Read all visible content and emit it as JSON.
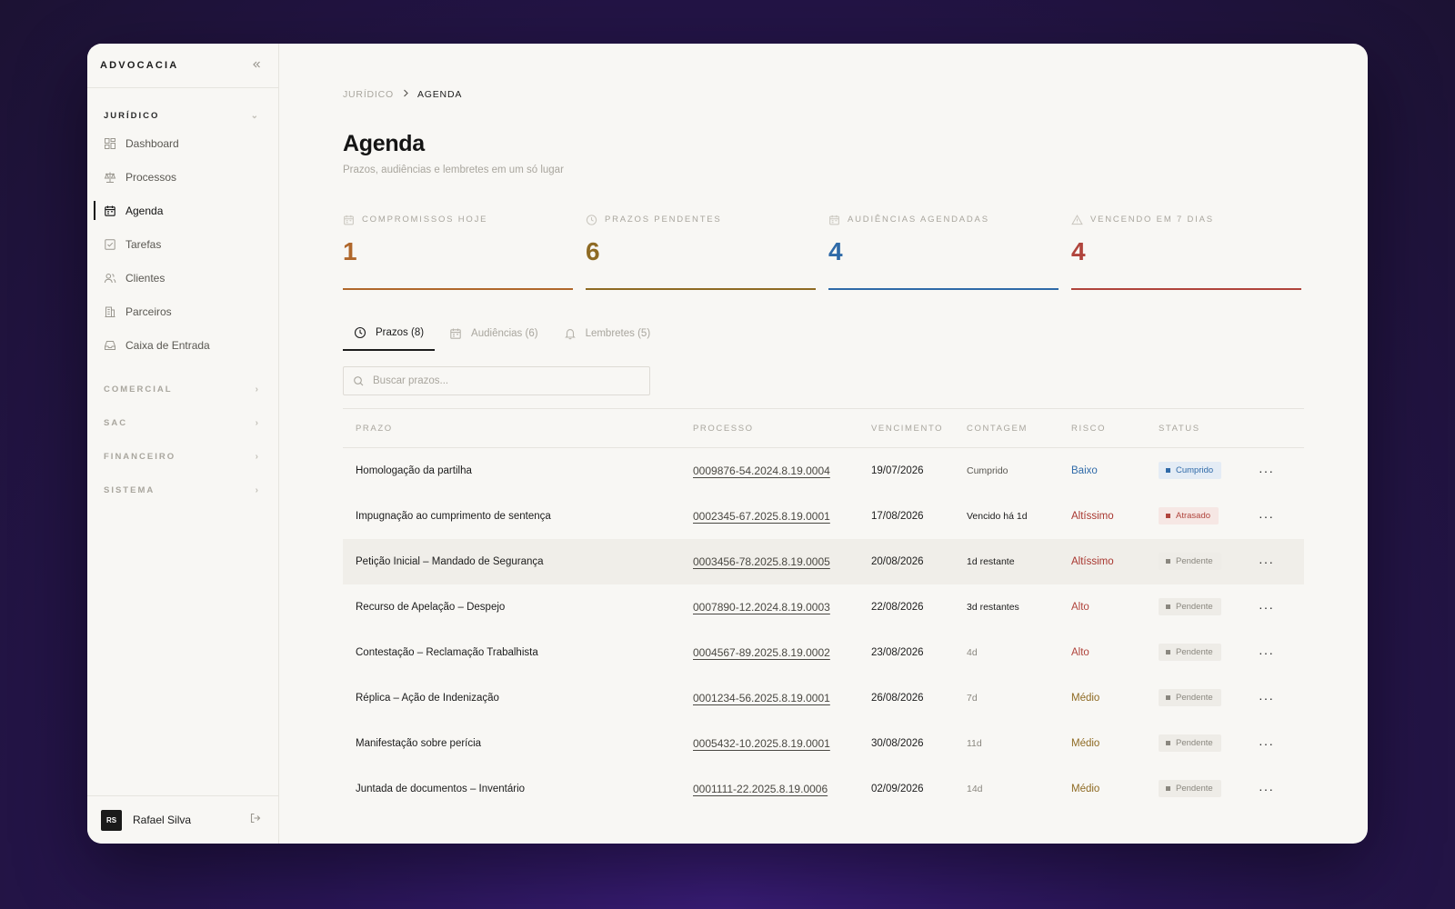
{
  "app": {
    "brand": "ADVOCACIA"
  },
  "sidebar": {
    "group_juridico": "JURÍDICO",
    "items": [
      {
        "label": "Dashboard",
        "icon": "dashboard-icon"
      },
      {
        "label": "Processos",
        "icon": "scale-icon"
      },
      {
        "label": "Agenda",
        "icon": "calendar-icon",
        "active": true
      },
      {
        "label": "Tarefas",
        "icon": "checkbox-icon"
      },
      {
        "label": "Clientes",
        "icon": "users-icon"
      },
      {
        "label": "Parceiros",
        "icon": "building-icon"
      },
      {
        "label": "Caixa de Entrada",
        "icon": "inbox-icon"
      }
    ],
    "groups": [
      "COMERCIAL",
      "SAC",
      "FINANCEIRO",
      "SISTEMA"
    ],
    "user": {
      "initials": "RS",
      "name": "Rafael Silva"
    }
  },
  "breadcrumb": {
    "root": "JURÍDICO",
    "current": "AGENDA"
  },
  "page": {
    "title": "Agenda",
    "subtitle": "Prazos, audiências e lembretes em um só lugar"
  },
  "stats": [
    {
      "label": "COMPROMISSOS HOJE",
      "value": "1",
      "color": "#b0672b",
      "icon": "calendar-icon"
    },
    {
      "label": "PRAZOS PENDENTES",
      "value": "6",
      "color": "#8e6a23",
      "icon": "clock-icon"
    },
    {
      "label": "AUDIÊNCIAS AGENDADAS",
      "value": "4",
      "color": "#2f6aa8",
      "icon": "calendar-icon"
    },
    {
      "label": "VENCENDO EM 7 DIAS",
      "value": "4",
      "color": "#b0443c",
      "icon": "warning-icon"
    }
  ],
  "tabs": [
    {
      "label": "Prazos (8)",
      "icon": "clock-icon",
      "active": true
    },
    {
      "label": "Audiências (6)",
      "icon": "calendar-icon"
    },
    {
      "label": "Lembretes (5)",
      "icon": "bell-icon"
    }
  ],
  "search": {
    "placeholder": "Buscar prazos...",
    "value": ""
  },
  "table": {
    "headers": [
      "PRAZO",
      "PROCESSO",
      "VENCIMENTO",
      "CONTAGEM",
      "RISCO",
      "STATUS"
    ],
    "rows": [
      {
        "prazo": "Homologação da partilha",
        "processo": "0009876-54.2024.8.19.0004",
        "vencimento": "19/07/2026",
        "contagem": "Cumprido",
        "risco": "Baixo",
        "status": "Cumprido"
      },
      {
        "prazo": "Impugnação ao cumprimento de sentença",
        "processo": "0002345-67.2025.8.19.0001",
        "vencimento": "17/08/2026",
        "contagem": "Vencido há 1d",
        "risco": "Altíssimo",
        "status": "Atrasado"
      },
      {
        "prazo": "Petição Inicial – Mandado de Segurança",
        "processo": "0003456-78.2025.8.19.0005",
        "vencimento": "20/08/2026",
        "contagem": "1d restante",
        "risco": "Altíssimo",
        "status": "Pendente"
      },
      {
        "prazo": "Recurso de Apelação – Despejo",
        "processo": "0007890-12.2024.8.19.0003",
        "vencimento": "22/08/2026",
        "contagem": "3d restantes",
        "risco": "Alto",
        "status": "Pendente"
      },
      {
        "prazo": "Contestação – Reclamação Trabalhista",
        "processo": "0004567-89.2025.8.19.0002",
        "vencimento": "23/08/2026",
        "contagem": "4d",
        "risco": "Alto",
        "status": "Pendente"
      },
      {
        "prazo": "Réplica – Ação de Indenização",
        "processo": "0001234-56.2025.8.19.0001",
        "vencimento": "26/08/2026",
        "contagem": "7d",
        "risco": "Médio",
        "status": "Pendente"
      },
      {
        "prazo": "Manifestação sobre perícia",
        "processo": "0005432-10.2025.8.19.0001",
        "vencimento": "30/08/2026",
        "contagem": "11d",
        "risco": "Médio",
        "status": "Pendente"
      },
      {
        "prazo": "Juntada de documentos – Inventário",
        "processo": "0001111-22.2025.8.19.0006",
        "vencimento": "02/09/2026",
        "contagem": "14d",
        "risco": "Médio",
        "status": "Pendente"
      }
    ]
  },
  "colors": {
    "risk_baixo": "#2f6aa8",
    "risk_altissimo": "#a8362f",
    "risk_alto": "#b0443c",
    "risk_medio": "#8e6a23",
    "status_cumprido_bg": "#e4ecf5",
    "status_cumprido_fg": "#2f6aa8",
    "status_atrasado_bg": "#f6e7e4",
    "status_atrasado_fg": "#b0443c",
    "status_pendente_bg": "#eeece7",
    "status_pendente_fg": "#8a877f",
    "count_strong": "#1c1c1c",
    "count_muted": "#8a877f"
  }
}
